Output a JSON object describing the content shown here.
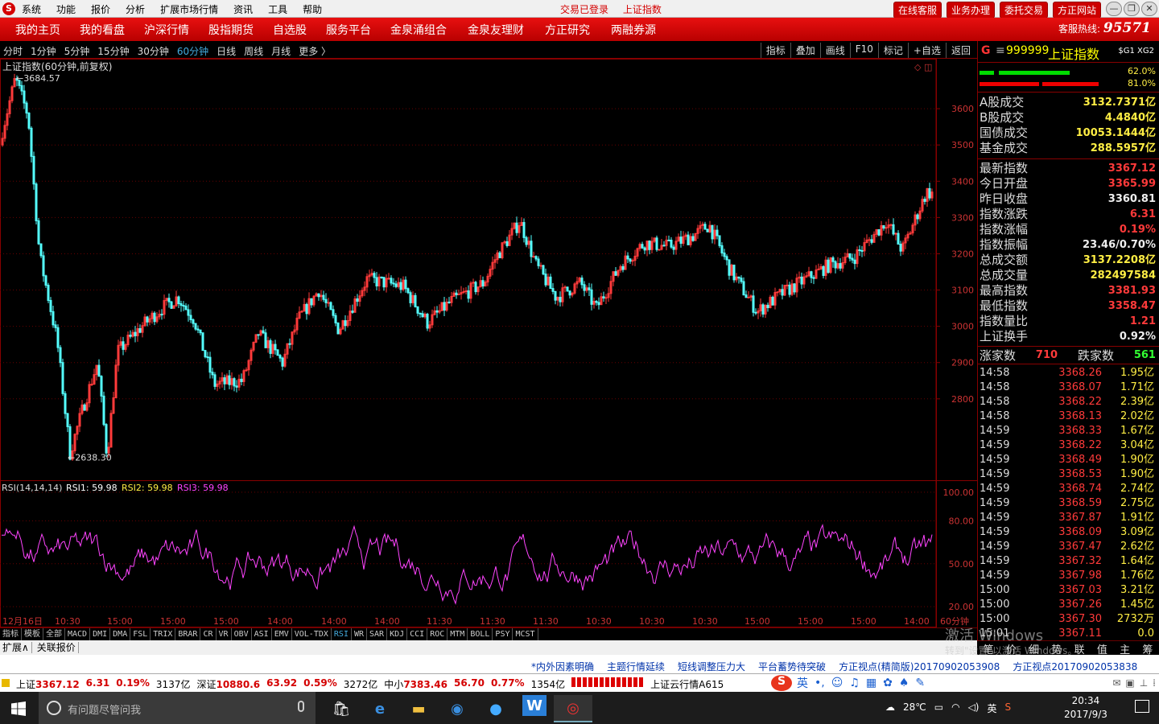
{
  "menubar": {
    "logo": "S",
    "items": [
      "系统",
      "功能",
      "报价",
      "分析",
      "扩展市场行情",
      "资讯",
      "工具",
      "帮助"
    ],
    "status": [
      "交易已登录",
      "上证指数"
    ],
    "buttons": [
      "在线客服",
      "业务办理",
      "委托交易",
      "方正网站"
    ],
    "window_controls": [
      "minimize-icon",
      "restore-icon",
      "close-icon"
    ]
  },
  "navbar": {
    "items": [
      "我的主页",
      "我的看盘",
      "沪深行情",
      "股指期货",
      "自选股",
      "服务平台",
      "金泉涌组合",
      "金泉友理财",
      "方正研究",
      "两融券源"
    ],
    "hotline_label": "客服热线:",
    "hotline_number": "95571"
  },
  "timeframes": [
    "分时",
    "1分钟",
    "5分钟",
    "15分钟",
    "30分钟",
    "60分钟",
    "日线",
    "周线",
    "月线",
    "更多 〉"
  ],
  "active_timeframe": "60分钟",
  "toolbar": [
    "指标",
    "叠加",
    "画线",
    "F10",
    "标记",
    "+自选",
    "返回"
  ],
  "chart_data": [
    {
      "type": "candlestick",
      "title": "上证指数(60分钟,前复权)",
      "y_ticks": [
        2800,
        2900,
        3000,
        3100,
        3200,
        3300,
        3400,
        3500,
        3600
      ],
      "ylim": [
        2580,
        3720
      ],
      "high_label": "3684.57",
      "low_label": "2638.30",
      "x_tick_labels": [
        "12月16日",
        "10:30",
        "15:00",
        "15:00",
        "15:00",
        "14:00",
        "14:00",
        "14:00",
        "11:30",
        "11:30",
        "11:30",
        "10:30",
        "10:30",
        "10:30",
        "15:00",
        "15:00",
        "15:00",
        "14:00",
        "60分钟"
      ],
      "colors": {
        "up": "#ff3a3a",
        "down": "#54ffff"
      }
    },
    {
      "type": "line",
      "title": "RSI(14,14,14)",
      "series": [
        {
          "name": "RSI1",
          "value": "59.98",
          "color": "#ffffff"
        },
        {
          "name": "RSI2",
          "value": "59.98",
          "color": "#ffee44"
        },
        {
          "name": "RSI3",
          "value": "59.98",
          "color": "#ff44ff"
        }
      ],
      "y_ticks": [
        "100.00",
        "80.00",
        "50.00",
        "20.00"
      ],
      "ylim": [
        15,
        105
      ]
    }
  ],
  "quote": {
    "g": "G",
    "menu": "≡",
    "code": "999999",
    "name": "上证指数",
    "tag": "$G1 XG2",
    "bar1_pct": "62.0%",
    "bar2_pct": "81.0%",
    "turnover": [
      {
        "l": "A股成交",
        "v": "3132.7371亿"
      },
      {
        "l": "B股成交",
        "v": "4.4840亿"
      },
      {
        "l": "国债成交",
        "v": "10053.1444亿"
      },
      {
        "l": "基金成交",
        "v": "288.5957亿"
      }
    ],
    "stats": [
      {
        "l": "最新指数",
        "v": "3367.12",
        "c": "red"
      },
      {
        "l": "今日开盘",
        "v": "3365.99",
        "c": "red"
      },
      {
        "l": "昨日收盘",
        "v": "3360.81",
        "c": "wht"
      },
      {
        "l": "指数涨跌",
        "v": "6.31",
        "c": "red"
      },
      {
        "l": "指数涨幅",
        "v": "0.19%",
        "c": "red"
      },
      {
        "l": "指数振幅",
        "v": "23.46/0.70%",
        "c": "wht"
      },
      {
        "l": "总成交额",
        "v": "3137.2208亿",
        "c": "yel"
      },
      {
        "l": "总成交量",
        "v": "282497584",
        "c": "yel"
      },
      {
        "l": "最高指数",
        "v": "3381.93",
        "c": "red"
      },
      {
        "l": "最低指数",
        "v": "3358.47",
        "c": "red"
      },
      {
        "l": "指数量比",
        "v": "1.21",
        "c": "red"
      },
      {
        "l": "上证换手",
        "v": "0.92%",
        "c": "wht"
      }
    ],
    "adv_label": "涨家数",
    "adv": "710",
    "dec_label": "跌家数",
    "dec": "561"
  },
  "ticks": [
    [
      "14:58",
      "3368.26",
      "1.95亿"
    ],
    [
      "14:58",
      "3368.07",
      "1.71亿"
    ],
    [
      "14:58",
      "3368.22",
      "2.39亿"
    ],
    [
      "14:58",
      "3368.13",
      "2.02亿"
    ],
    [
      "14:59",
      "3368.33",
      "1.67亿"
    ],
    [
      "14:59",
      "3368.22",
      "3.04亿"
    ],
    [
      "14:59",
      "3368.49",
      "1.90亿"
    ],
    [
      "14:59",
      "3368.53",
      "1.90亿"
    ],
    [
      "14:59",
      "3368.74",
      "2.74亿"
    ],
    [
      "14:59",
      "3368.59",
      "2.75亿"
    ],
    [
      "14:59",
      "3367.87",
      "1.91亿"
    ],
    [
      "14:59",
      "3368.09",
      "3.09亿"
    ],
    [
      "14:59",
      "3367.47",
      "2.62亿"
    ],
    [
      "14:59",
      "3367.32",
      "1.64亿"
    ],
    [
      "14:59",
      "3367.98",
      "1.76亿"
    ],
    [
      "15:00",
      "3367.03",
      "3.21亿"
    ],
    [
      "15:00",
      "3367.26",
      "1.45亿"
    ],
    [
      "15:00",
      "3367.30",
      "2732万"
    ],
    [
      "15:01",
      "3367.11",
      "0.0"
    ]
  ],
  "indicator_tabs": [
    "指标",
    "模板",
    "全部",
    "MACD",
    "DMI",
    "DMA",
    "FSL",
    "TRIX",
    "BRAR",
    "CR",
    "VR",
    "OBV",
    "ASI",
    "EMV",
    "VOL-TDX",
    "RSI",
    "WR",
    "SAR",
    "KDJ",
    "CCI",
    "ROC",
    "MTM",
    "BOLL",
    "PSY",
    "MCST"
  ],
  "active_indicator": "RSI",
  "bottom_tabs": [
    "扩展∧",
    "关联报价"
  ],
  "right_tabs": [
    "笔",
    "价",
    "细",
    "势",
    "联",
    "值",
    "主",
    "筹"
  ],
  "news": [
    "*内外因素明确",
    "主题行情延续",
    "短线调整压力大",
    "平台蓄势待突破",
    "方正视点(精简版)20170902053908",
    "方正视点20170902053838"
  ],
  "market": {
    "sh_label": "上证",
    "sh": "3367.12",
    "sh_chg": "6.31",
    "sh_pct": "0.19%",
    "sh_amt": "3137亿",
    "sz_label": "深证",
    "sz": "10880.6",
    "sz_chg": "63.92",
    "sz_pct": "0.59%",
    "sz_amt": "3272亿",
    "zx_label": "中小",
    "zx": "7383.46",
    "zx_chg": "56.70",
    "zx_pct": "0.77%",
    "zx_amt": "1354亿",
    "cloud": "上证云行情A615"
  },
  "watermark": {
    "line1": "激活 Windows",
    "line2": "转到\"设置\"以激活 Windows。"
  },
  "taskbar": {
    "search_placeholder": "有问题尽管问我",
    "weather": "28℃",
    "ime": "英",
    "time": "20:34",
    "date": "2017/9/3"
  }
}
